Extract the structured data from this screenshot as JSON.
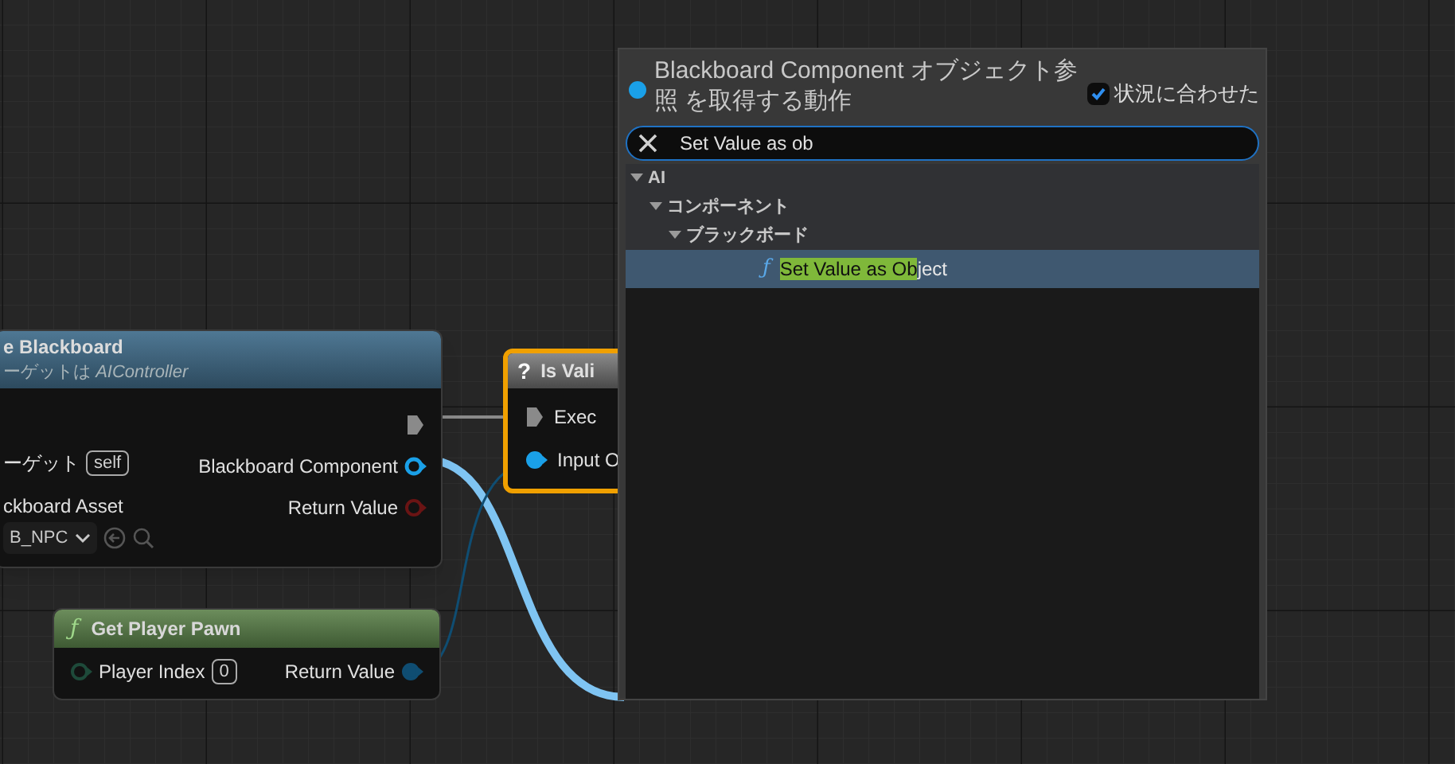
{
  "blackboard_node": {
    "title": "e Blackboard",
    "subtitle": "ーゲットは *AIController*",
    "inputs": [
      {
        "kind": "object",
        "label": "ーゲット",
        "value": "self"
      },
      {
        "kind": "asset",
        "label": "ckboard Asset",
        "value": "B_NPC"
      }
    ],
    "outputs": [
      {
        "kind": "exec"
      },
      {
        "kind": "data",
        "label": "Blackboard Component",
        "connected": true,
        "color": "#1aa0e8"
      },
      {
        "kind": "data",
        "label": "Return Value",
        "connected": false,
        "color": "#6a1414"
      }
    ]
  },
  "player_pawn_node": {
    "icon": "ƒ",
    "title": "Get Player Pawn",
    "inputs": [
      {
        "label": "Player Index",
        "value": "0",
        "connected": false
      }
    ],
    "outputs": [
      {
        "label": "Return Value",
        "connected": true
      }
    ]
  },
  "is_valid_node": {
    "icon": "?",
    "title": "Is Vali",
    "selected": true,
    "inputs": [
      {
        "kind": "exec",
        "label": "Exec"
      },
      {
        "kind": "data",
        "label": "Input O",
        "connected": true
      }
    ]
  },
  "action_menu": {
    "title": "Blackboard Component オブジェクト参照 を取得する動作",
    "context_sensitive": {
      "label": "状況に合わせた",
      "checked": true
    },
    "search": {
      "value": "Set Value as ob"
    },
    "tree": [
      {
        "label": "AI",
        "expanded": true,
        "children": [
          {
            "label": "コンポーネント",
            "expanded": true,
            "children": [
              {
                "label": "ブラックボード",
                "expanded": true,
                "children": [
                  {
                    "kind": "function",
                    "icon": "ƒ",
                    "match": "Set Value as Ob",
                    "rest": "ject",
                    "selected": true
                  }
                ]
              }
            ]
          }
        ]
      }
    ]
  }
}
